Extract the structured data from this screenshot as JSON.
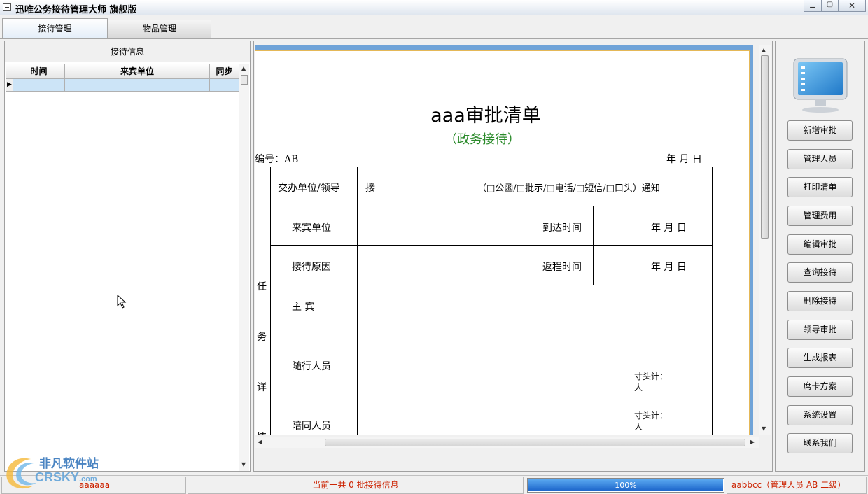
{
  "window": {
    "title": "迅唯公务接待管理大师 旗舰版",
    "controls": [
      "minimize-icon",
      "maximize-icon",
      "close-icon"
    ]
  },
  "tabs": [
    {
      "label": "接待管理",
      "active": true
    },
    {
      "label": "物品管理",
      "active": false
    }
  ],
  "left_panel": {
    "header": "接待信息",
    "columns": [
      "时间",
      "来宾单位",
      "同步"
    ],
    "rows": [
      [
        "",
        "",
        ""
      ]
    ]
  },
  "document": {
    "title": "aaa审批清单",
    "subtitle": "（政务接待）",
    "number_label": "编号：",
    "number_value": "AB",
    "date_header": "年  月  日",
    "side_label": [
      "任",
      "务",
      "详",
      "情"
    ],
    "row_assign_label": "交办单位/领导",
    "row_assign_receive": "接",
    "row_assign_methods": "（□公函/□批示/□电话/□短信/□口头）通知",
    "visitor_unit_label": "来宾单位",
    "arrival_time_label": "到达时间",
    "arrival_date": "年  月  日",
    "reason_label": "接待原因",
    "return_time_label": "返程时间",
    "return_date": "年  月  日",
    "main_guest_label": "主    宾",
    "accompany_label": "随行人员",
    "escort_label": "陪同人员",
    "count_label_1": "寸头计：",
    "count_unit_1": "人",
    "count_label_2": "寸头计：",
    "count_unit_2": "人"
  },
  "right_panel": {
    "icon": "computer-monitor-icon",
    "buttons": [
      "新增审批",
      "管理人员",
      "打印清单",
      "管理费用",
      "编辑审批",
      "查询接待",
      "删除接待",
      "领导审批",
      "生成报表",
      "席卡方案",
      "系统设置",
      "联系我们"
    ]
  },
  "status_bar": {
    "left_text": "aaaaaa",
    "summary": "当前一共 0 批接待信息",
    "progress_value": 1.0,
    "progress_text": "100%",
    "user_info": "aabbcc（管理人员   AB   二级）"
  },
  "watermark": {
    "cn": "非凡软件站",
    "en": "CRSKY",
    "dotcom": ".com"
  },
  "colors": {
    "accent_blue": "#1a63c9",
    "subtitle_green": "#2a8a2a",
    "status_red": "#cc2200",
    "paper_border": "#e5b857"
  }
}
